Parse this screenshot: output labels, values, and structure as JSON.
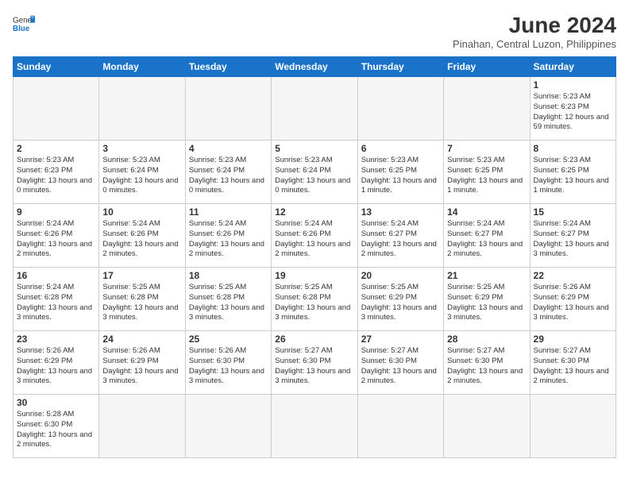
{
  "header": {
    "logo_general": "General",
    "logo_blue": "Blue",
    "month_title": "June 2024",
    "subtitle": "Pinahan, Central Luzon, Philippines"
  },
  "weekdays": [
    "Sunday",
    "Monday",
    "Tuesday",
    "Wednesday",
    "Thursday",
    "Friday",
    "Saturday"
  ],
  "weeks": [
    [
      {
        "day": "",
        "info": ""
      },
      {
        "day": "",
        "info": ""
      },
      {
        "day": "",
        "info": ""
      },
      {
        "day": "",
        "info": ""
      },
      {
        "day": "",
        "info": ""
      },
      {
        "day": "",
        "info": ""
      },
      {
        "day": "1",
        "info": "Sunrise: 5:23 AM\nSunset: 6:23 PM\nDaylight: 12 hours\nand 59 minutes."
      }
    ],
    [
      {
        "day": "2",
        "info": "Sunrise: 5:23 AM\nSunset: 6:23 PM\nDaylight: 13 hours\nand 0 minutes."
      },
      {
        "day": "3",
        "info": "Sunrise: 5:23 AM\nSunset: 6:24 PM\nDaylight: 13 hours\nand 0 minutes."
      },
      {
        "day": "4",
        "info": "Sunrise: 5:23 AM\nSunset: 6:24 PM\nDaylight: 13 hours\nand 0 minutes."
      },
      {
        "day": "5",
        "info": "Sunrise: 5:23 AM\nSunset: 6:24 PM\nDaylight: 13 hours\nand 0 minutes."
      },
      {
        "day": "6",
        "info": "Sunrise: 5:23 AM\nSunset: 6:25 PM\nDaylight: 13 hours\nand 1 minute."
      },
      {
        "day": "7",
        "info": "Sunrise: 5:23 AM\nSunset: 6:25 PM\nDaylight: 13 hours\nand 1 minute."
      },
      {
        "day": "8",
        "info": "Sunrise: 5:23 AM\nSunset: 6:25 PM\nDaylight: 13 hours\nand 1 minute."
      }
    ],
    [
      {
        "day": "9",
        "info": "Sunrise: 5:24 AM\nSunset: 6:26 PM\nDaylight: 13 hours\nand 2 minutes."
      },
      {
        "day": "10",
        "info": "Sunrise: 5:24 AM\nSunset: 6:26 PM\nDaylight: 13 hours\nand 2 minutes."
      },
      {
        "day": "11",
        "info": "Sunrise: 5:24 AM\nSunset: 6:26 PM\nDaylight: 13 hours\nand 2 minutes."
      },
      {
        "day": "12",
        "info": "Sunrise: 5:24 AM\nSunset: 6:26 PM\nDaylight: 13 hours\nand 2 minutes."
      },
      {
        "day": "13",
        "info": "Sunrise: 5:24 AM\nSunset: 6:27 PM\nDaylight: 13 hours\nand 2 minutes."
      },
      {
        "day": "14",
        "info": "Sunrise: 5:24 AM\nSunset: 6:27 PM\nDaylight: 13 hours\nand 2 minutes."
      },
      {
        "day": "15",
        "info": "Sunrise: 5:24 AM\nSunset: 6:27 PM\nDaylight: 13 hours\nand 3 minutes."
      }
    ],
    [
      {
        "day": "16",
        "info": "Sunrise: 5:24 AM\nSunset: 6:28 PM\nDaylight: 13 hours\nand 3 minutes."
      },
      {
        "day": "17",
        "info": "Sunrise: 5:25 AM\nSunset: 6:28 PM\nDaylight: 13 hours\nand 3 minutes."
      },
      {
        "day": "18",
        "info": "Sunrise: 5:25 AM\nSunset: 6:28 PM\nDaylight: 13 hours\nand 3 minutes."
      },
      {
        "day": "19",
        "info": "Sunrise: 5:25 AM\nSunset: 6:28 PM\nDaylight: 13 hours\nand 3 minutes."
      },
      {
        "day": "20",
        "info": "Sunrise: 5:25 AM\nSunset: 6:29 PM\nDaylight: 13 hours\nand 3 minutes."
      },
      {
        "day": "21",
        "info": "Sunrise: 5:25 AM\nSunset: 6:29 PM\nDaylight: 13 hours\nand 3 minutes."
      },
      {
        "day": "22",
        "info": "Sunrise: 5:26 AM\nSunset: 6:29 PM\nDaylight: 13 hours\nand 3 minutes."
      }
    ],
    [
      {
        "day": "23",
        "info": "Sunrise: 5:26 AM\nSunset: 6:29 PM\nDaylight: 13 hours\nand 3 minutes."
      },
      {
        "day": "24",
        "info": "Sunrise: 5:26 AM\nSunset: 6:29 PM\nDaylight: 13 hours\nand 3 minutes."
      },
      {
        "day": "25",
        "info": "Sunrise: 5:26 AM\nSunset: 6:30 PM\nDaylight: 13 hours\nand 3 minutes."
      },
      {
        "day": "26",
        "info": "Sunrise: 5:27 AM\nSunset: 6:30 PM\nDaylight: 13 hours\nand 3 minutes."
      },
      {
        "day": "27",
        "info": "Sunrise: 5:27 AM\nSunset: 6:30 PM\nDaylight: 13 hours\nand 2 minutes."
      },
      {
        "day": "28",
        "info": "Sunrise: 5:27 AM\nSunset: 6:30 PM\nDaylight: 13 hours\nand 2 minutes."
      },
      {
        "day": "29",
        "info": "Sunrise: 5:27 AM\nSunset: 6:30 PM\nDaylight: 13 hours\nand 2 minutes."
      }
    ],
    [
      {
        "day": "30",
        "info": "Sunrise: 5:28 AM\nSunset: 6:30 PM\nDaylight: 13 hours\nand 2 minutes."
      },
      {
        "day": "",
        "info": ""
      },
      {
        "day": "",
        "info": ""
      },
      {
        "day": "",
        "info": ""
      },
      {
        "day": "",
        "info": ""
      },
      {
        "day": "",
        "info": ""
      },
      {
        "day": "",
        "info": ""
      }
    ]
  ]
}
